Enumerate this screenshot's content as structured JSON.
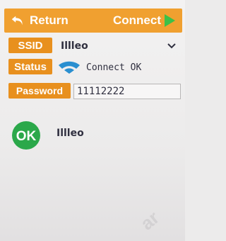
{
  "topbar": {
    "return_label": "Return",
    "connect_label": "Connect",
    "accent_color": "#f0a030",
    "play_color": "#3cc048"
  },
  "ssid": {
    "label": "SSID",
    "value": "Illleo"
  },
  "status": {
    "label": "Status",
    "text": "Connect OK",
    "icon": "wifi-icon"
  },
  "password": {
    "label": "Password",
    "value": "11112222"
  },
  "result": {
    "badge": "OK",
    "badge_color": "#2ba84a",
    "device_name": "Illleo"
  },
  "watermark": "ar"
}
